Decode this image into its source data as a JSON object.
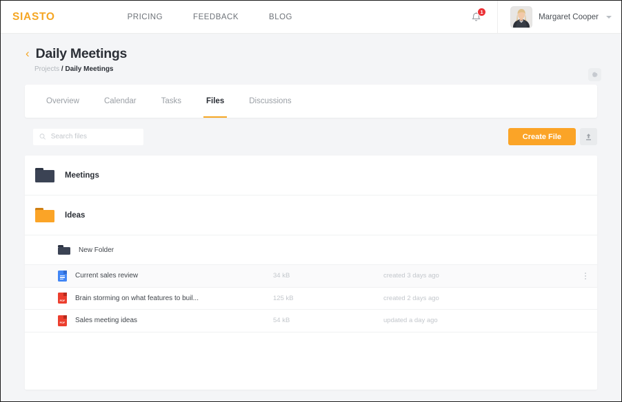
{
  "navbar": {
    "logo": "SIASTO",
    "links": [
      {
        "label": "PRICING"
      },
      {
        "label": "FEEDBACK"
      },
      {
        "label": "BLOG"
      }
    ],
    "notification_count": "1",
    "user_name": "Margaret Cooper",
    "bell_icon": "bell-icon",
    "avatar_icon": "user-avatar",
    "caret_icon": "chevron-down-icon"
  },
  "header": {
    "back_chevron": "‹",
    "title": "Daily Meetings",
    "breadcrumb_parent": "Projects",
    "breadcrumb_sep": "/",
    "breadcrumb_current": "Daily Meetings",
    "settings_icon": "gear-icon"
  },
  "tabs": [
    {
      "label": "Overview",
      "active": false
    },
    {
      "label": "Calendar",
      "active": false
    },
    {
      "label": "Tasks",
      "active": false
    },
    {
      "label": "Files",
      "active": true
    },
    {
      "label": "Discussions",
      "active": false
    }
  ],
  "toolbar": {
    "search_placeholder": "Search files",
    "search_value": "",
    "search_icon": "search-icon",
    "create_label": "Create File",
    "upload_icon": "upload-icon"
  },
  "files": [
    {
      "name": "Meetings",
      "type": "folder",
      "icon": "folder-icon-dark",
      "color": "#3b4354",
      "size": "",
      "time": "",
      "nested": false,
      "hovered": false,
      "menu": false
    },
    {
      "name": "Ideas",
      "type": "folder",
      "icon": "folder-icon-orange",
      "color": "#fba427",
      "size": "",
      "time": "",
      "nested": false,
      "hovered": false,
      "menu": false
    },
    {
      "name": "New Folder",
      "type": "folder-small",
      "icon": "folder-icon-dark",
      "color": "#3b4354",
      "size": "",
      "time": "",
      "nested": true,
      "hovered": false,
      "menu": false
    },
    {
      "name": "Current sales review",
      "type": "doc",
      "icon": "google-doc-icon",
      "color": "#4286f5",
      "size": "34 kB",
      "time": "created 3 days ago",
      "nested": true,
      "hovered": true,
      "menu": true
    },
    {
      "name": "Brain storming on what features to buil...",
      "type": "pdf",
      "icon": "pdf-file-icon",
      "color": "#ec3e2e",
      "size": "125 kB",
      "time": "created 2 days ago",
      "nested": true,
      "hovered": false,
      "menu": false
    },
    {
      "name": "Sales meeting ideas",
      "type": "pdf",
      "icon": "pdf-file-icon",
      "color": "#ec3e2e",
      "size": "54 kB",
      "time": "updated a day ago",
      "nested": true,
      "hovered": false,
      "menu": false
    }
  ],
  "colors": {
    "accent": "#f5a623",
    "create_button": "#fba427",
    "badge": "#ec3237",
    "folder_dark": "#3b4354",
    "pdf_red": "#ec3e2e",
    "doc_blue": "#4286f5",
    "page_bg": "#f4f5f7"
  }
}
